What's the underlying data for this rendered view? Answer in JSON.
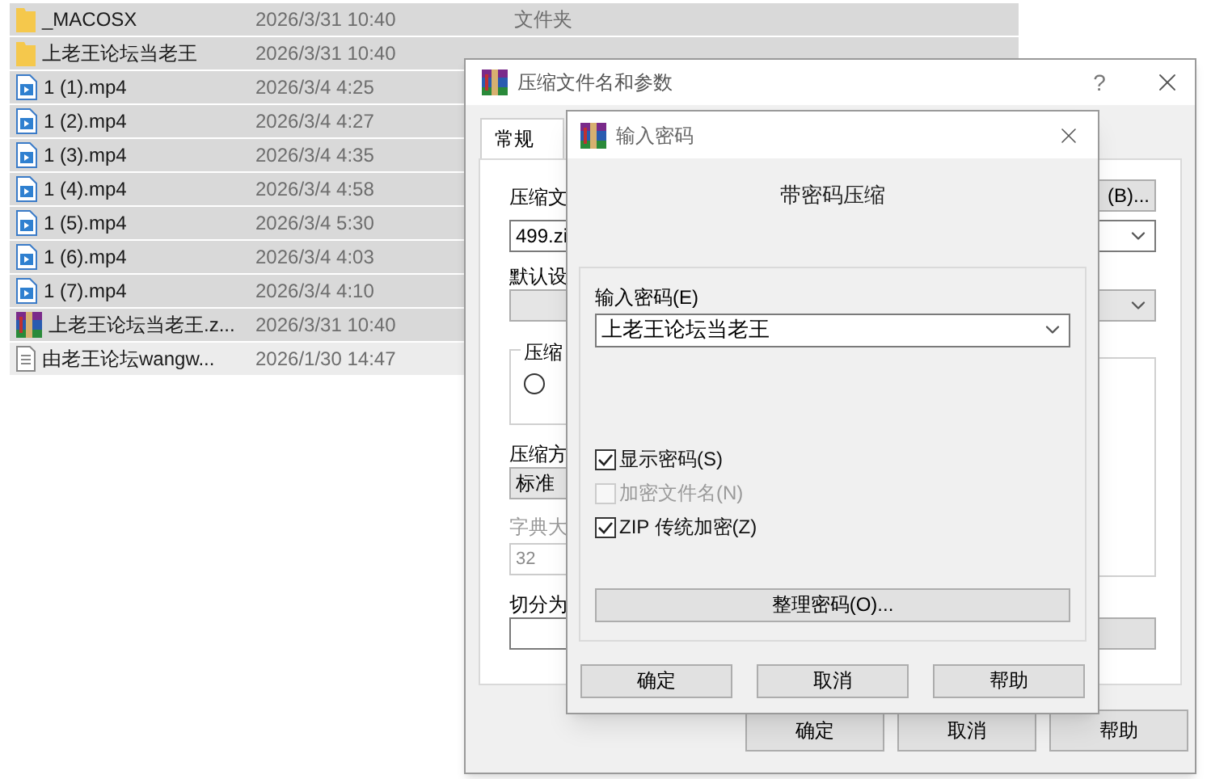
{
  "files": [
    {
      "name": "_MACOSX",
      "date": "2026/3/31 10:40",
      "type": "文件夹",
      "kind": "folder",
      "selected": true
    },
    {
      "name": "上老王论坛当老王",
      "date": "2026/3/31 10:40",
      "kind": "folder",
      "selected": true
    },
    {
      "name": "1 (1).mp4",
      "date": "2026/3/4 4:25",
      "kind": "video",
      "selected": true
    },
    {
      "name": "1 (2).mp4",
      "date": "2026/3/4 4:27",
      "kind": "video",
      "selected": true
    },
    {
      "name": "1 (3).mp4",
      "date": "2026/3/4 4:35",
      "kind": "video",
      "selected": true
    },
    {
      "name": "1 (4).mp4",
      "date": "2026/3/4 4:58",
      "kind": "video",
      "selected": true
    },
    {
      "name": "1 (5).mp4",
      "date": "2026/3/4 5:30",
      "kind": "video",
      "selected": true
    },
    {
      "name": "1 (6).mp4",
      "date": "2026/3/4 4:03",
      "kind": "video",
      "selected": true
    },
    {
      "name": "1 (7).mp4",
      "date": "2026/3/4 4:10",
      "kind": "video",
      "selected": true
    },
    {
      "name": "上老王论坛当老王.z...",
      "date": "2026/3/31 10:40",
      "kind": "archive",
      "selected": true
    },
    {
      "name": "由老王论坛wangw...",
      "date": "2026/1/30 14:47",
      "kind": "text",
      "selected": false
    }
  ],
  "back_dialog": {
    "title": "压缩文件名和参数",
    "help": "?",
    "tabs": [
      {
        "label": "常规",
        "selected": true
      }
    ],
    "archive_name_label": "压缩文",
    "browse_button": "(B)...",
    "archive_name": "499.zi",
    "profile_label": "默认设",
    "group_label": "压缩",
    "radio_selected": false,
    "method_label": "压缩方",
    "method": "标准",
    "dict_label": "字典大",
    "dict": "32",
    "dict_disabled": true,
    "split_label": "切分为",
    "buttons": [
      "确定",
      "取消",
      "帮助"
    ]
  },
  "password_dialog": {
    "title": "输入密码",
    "heading": "带密码压缩",
    "password_label": "输入密码(E)",
    "password": "上老王论坛当老王",
    "options": [
      {
        "label": "显示密码(S)",
        "checked": true,
        "disabled": false
      },
      {
        "label": "加密文件名(N)",
        "checked": false,
        "disabled": true
      },
      {
        "label": "ZIP 传统加密(Z)",
        "checked": true,
        "disabled": false
      }
    ],
    "organize_button": "整理密码(O)...",
    "buttons": [
      "确定",
      "取消",
      "帮助"
    ]
  }
}
